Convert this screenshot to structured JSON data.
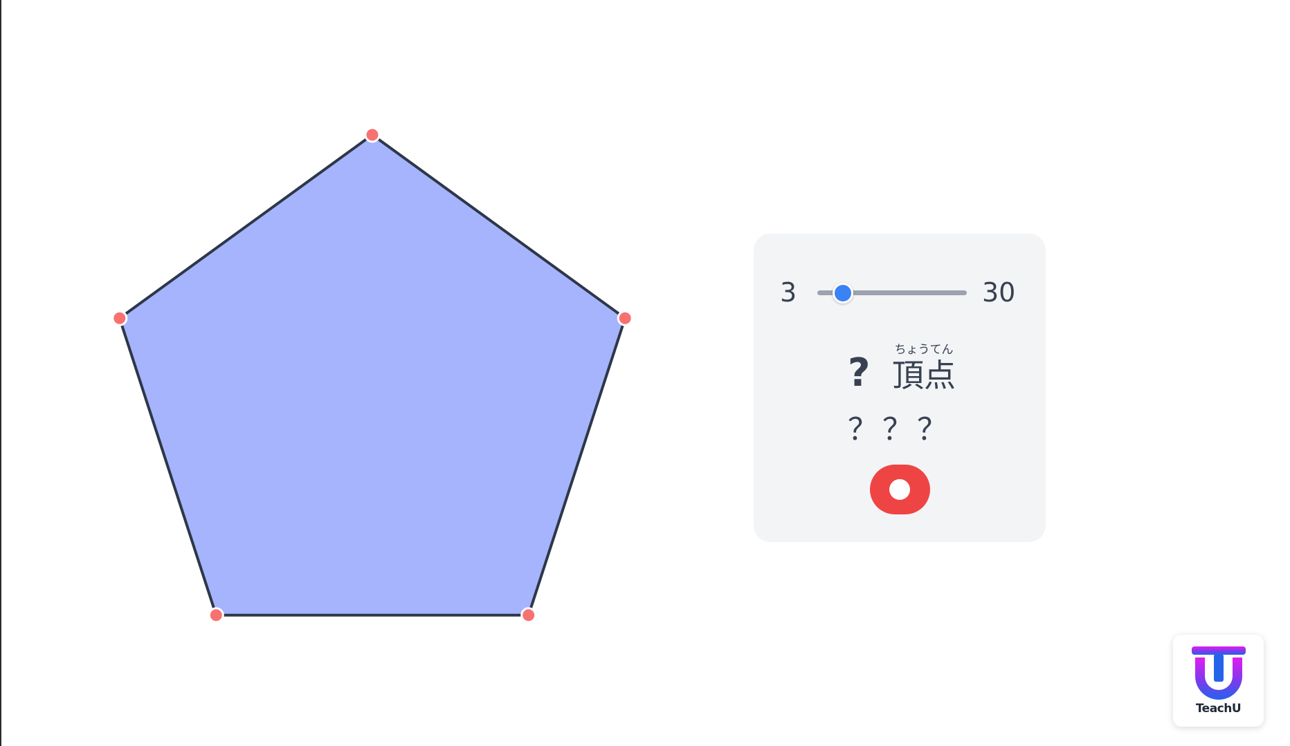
{
  "polygon": {
    "sides": 5,
    "fill_color": "#a5b4fc",
    "stroke_color": "#2d3748",
    "vertex_color": "#f87171"
  },
  "controls": {
    "slider_min_label": "3",
    "slider_max_label": "30",
    "slider_value": 5,
    "vertex_count": "?",
    "vertex_word": "頂点",
    "vertex_ruby": "ちょうてん",
    "shape_name": "？？？",
    "accent_color": "#3b82f6",
    "record_color": "#ef4444"
  },
  "logo": {
    "text": "TeachU",
    "icon": "teachu-logo-icon"
  }
}
